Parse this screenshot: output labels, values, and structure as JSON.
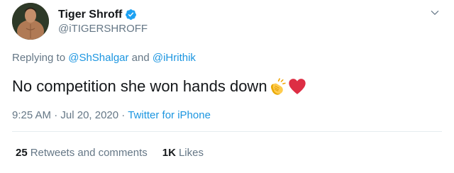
{
  "author": {
    "name": "Tiger Shroff",
    "handle": "@iTIGERSHROFF"
  },
  "reply": {
    "prefix": "Replying to",
    "mention1": "@ShShalgar",
    "and_word": "and",
    "mention2": "@iHrithik"
  },
  "tweet": {
    "text": "No competition she won hands down",
    "emojis": [
      "clapping-hands-emoji",
      "red-heart-emoji"
    ]
  },
  "meta": {
    "time": "9:25 AM",
    "date": "Jul 20, 2020",
    "separator": "·",
    "source": "Twitter for iPhone"
  },
  "stats": {
    "retweets_count": "25",
    "retweets_label": "Retweets and comments",
    "likes_count": "1K",
    "likes_label": "Likes"
  },
  "colors": {
    "link": "#1b95e0",
    "secondary_text": "#657786",
    "verified": "#1da1f2",
    "heart": "#e0245e"
  }
}
